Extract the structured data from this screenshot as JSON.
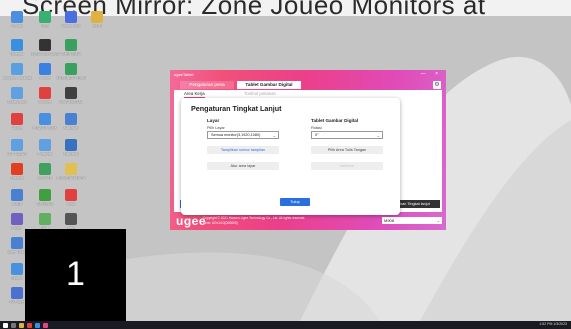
{
  "banner": {
    "text": "Screen Mirror: Zone Joueo Monitors at"
  },
  "desktop_icons": [
    {
      "label": "PC Ian",
      "color": "#4a8fe0"
    },
    {
      "label": "ISIS",
      "color": "#3ab070"
    },
    {
      "label": "Magna 800",
      "color": "#4a6fe0"
    },
    {
      "label": "ImHR",
      "color": "#e0b040"
    },
    {
      "label": "Notepad",
      "color": "#3a90e0"
    },
    {
      "label": "LOGICA DE TUGAS",
      "color": "#333333"
    },
    {
      "label": "SMKN SIMA",
      "color": "#3aa060"
    },
    {
      "label": "Komputer Jaringan",
      "color": "#5aa0e0"
    },
    {
      "label": "Adobe",
      "color": "#3a80e0"
    },
    {
      "label": "INTERNET PRIBADI",
      "color": "#3aa060"
    },
    {
      "label": "Folder Baru",
      "color": "#60a0e0"
    },
    {
      "label": "Chrome",
      "color": "#e04040"
    },
    {
      "label": "ALAT DIGITAL",
      "color": "#404040"
    },
    {
      "label": "Adobe",
      "color": "#e04040"
    },
    {
      "label": "PRAKTIK SMK",
      "color": "#4a90e0"
    },
    {
      "label": "Microsoft",
      "color": "#4a80d0"
    },
    {
      "label": "ICT TUGAS",
      "color": "#60a0e0"
    },
    {
      "label": "Pratinjau",
      "color": "#60a0e0"
    },
    {
      "label": "Microsoft",
      "color": "#3a70c0"
    },
    {
      "label": "Firewall",
      "color": "#e04020"
    },
    {
      "label": "UPDATE",
      "color": "#40a060"
    },
    {
      "label": "PROGRAM DATA",
      "color": "#e0c050"
    },
    {
      "label": "UGEE",
      "color": "#4a80d0"
    },
    {
      "label": "DRIVERS",
      "color": "#40a040"
    },
    {
      "label": "Arsip",
      "color": "#e04040"
    },
    {
      "label": "Folder",
      "color": "#7060c0"
    },
    {
      "label": "Note",
      "color": "#60b060"
    },
    {
      "label": "Pen",
      "color": "#555555"
    },
    {
      "label": "ugee Tablet",
      "color": "#4a80d0"
    },
    {
      "label": "Search",
      "color": "#4a90e0"
    },
    {
      "label": "TV Player",
      "color": "#4a70d0"
    }
  ],
  "app": {
    "title": "ugeeTablet",
    "window_controls": "— ×",
    "tabs": [
      {
        "label": "Pengaturan pena"
      },
      {
        "label": "Tablet Gambar Digital"
      }
    ],
    "subtabs": [
      {
        "label": "Area Kerja"
      },
      {
        "label": "Tombol pintasan"
      }
    ],
    "left_button_label": "",
    "right_button_label": "kan Tingkat lanjut",
    "footer": {
      "logo": "ugee",
      "copyright": "Copyright © 2021 Hanvon Ugee Technology Co., Ltd. All rights reserved.",
      "version": "Versi: UGv14.0(D00000)",
      "device": "M908"
    }
  },
  "modal": {
    "title": "Pengaturan Tingkat Lanjut",
    "layar": {
      "title": "Layar",
      "pilih_label": "Pilih Layar",
      "selected": "Semua monitor(3,1920,1080)",
      "tampilkan": "Tampilkan nomor tampilan",
      "atur": "Atur area layar"
    },
    "tablet": {
      "title": "Tablet Gambar Digital",
      "rotasi_label": "Rotasi",
      "selected": "0°",
      "pilih_area": "Pilih Area Tulis Tangan",
      "kalibrasi": "Kalibrasi"
    },
    "tutup": "Tutup"
  },
  "overlay_number": "1",
  "taskbar": {
    "clock": "1:52 PM 1/3/2023"
  },
  "colors": {
    "accent_blue": "#2a6fe0",
    "app_pink": "#ec3f8a",
    "app_purple": "#d86ad0"
  }
}
